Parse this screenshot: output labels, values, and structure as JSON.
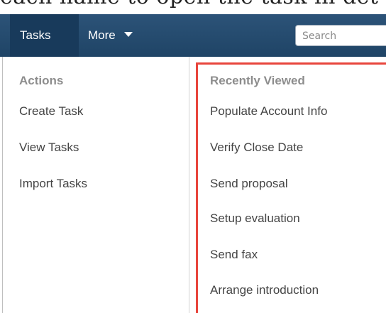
{
  "caption": "each name to open the task in det",
  "nav": {
    "tasks_tab": "Tasks",
    "more_tab": "More",
    "search_placeholder": "Search"
  },
  "actions": {
    "title": "Actions",
    "items": [
      "Create Task",
      "View Tasks",
      "Import Tasks"
    ]
  },
  "recent": {
    "title": "Recently Viewed",
    "items": [
      "Populate Account Info",
      "Verify Close Date",
      "Send proposal",
      "Setup evaluation",
      "Send fax",
      "Arrange introduction"
    ]
  },
  "colors": {
    "navbar": "#1f4466",
    "active_tab": "#183a5b",
    "highlight": "#e8453c"
  }
}
